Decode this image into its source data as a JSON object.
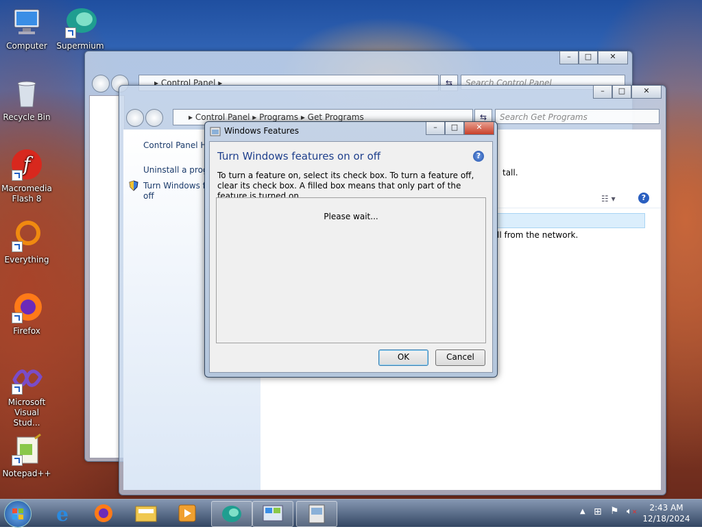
{
  "desktop": {
    "icons": [
      {
        "label": "Computer",
        "icon": "computer-icon"
      },
      {
        "label": "Supermium",
        "icon": "supermium-icon"
      },
      {
        "label": "Recycle Bin",
        "icon": "recycle-bin-icon"
      },
      {
        "label": "Macromedia Flash 8",
        "icon": "flash-icon"
      },
      {
        "label": "Everything",
        "icon": "everything-icon"
      },
      {
        "label": "Firefox",
        "icon": "firefox-icon"
      },
      {
        "label": "Microsoft Visual Stud...",
        "icon": "visual-studio-icon"
      },
      {
        "label": "Notepad++",
        "icon": "notepadpp-icon"
      }
    ]
  },
  "back_window": {
    "address": "Control Panel",
    "search_placeholder": "Search Control Panel"
  },
  "programs_window": {
    "address": [
      "Control Panel",
      "Programs",
      "Get Programs"
    ],
    "search_placeholder": "Search Get Programs",
    "sidebar": {
      "home_link": "Control Panel Ho",
      "uninstall_link": "Uninstall a progr",
      "features_link_line1": "Turn Windows fe",
      "features_link_line2": "off"
    },
    "content": {
      "instructions_tail": "tall.",
      "network_tail": "ll from the network."
    }
  },
  "dialog": {
    "title": "Windows Features",
    "heading": "Turn Windows features on or off",
    "description": "To turn a feature on, select its check box. To turn a feature off, clear its check box. A filled box means that only part of the feature is turned on.",
    "status": "Please wait...",
    "ok_label": "OK",
    "cancel_label": "Cancel"
  },
  "taskbar": {
    "time": "2:43 AM",
    "date": "12/18/2024"
  }
}
